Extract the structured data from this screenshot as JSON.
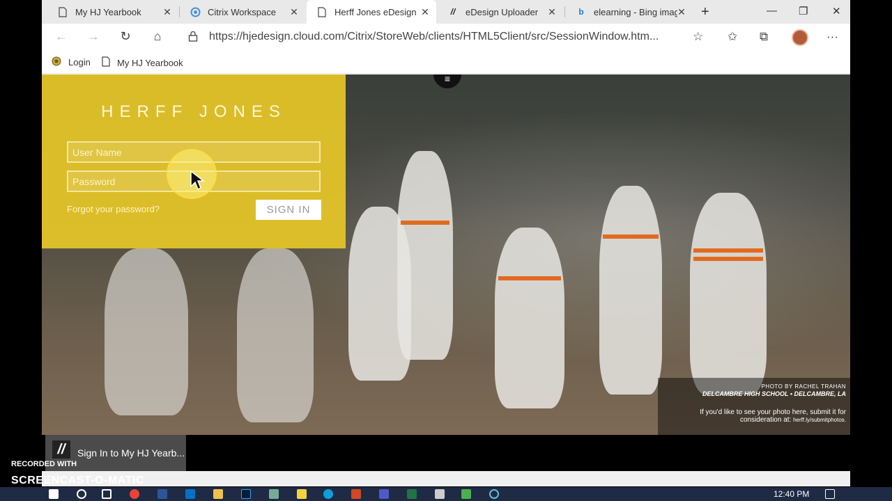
{
  "tabs": [
    {
      "label": "My HJ Yearbook",
      "icon": "page-icon",
      "active": false
    },
    {
      "label": "Citrix Workspace",
      "icon": "citrix-icon",
      "active": false
    },
    {
      "label": "Herff Jones eDesign",
      "icon": "page-icon",
      "active": true
    },
    {
      "label": "eDesign Uploader",
      "icon": "hj-logo-icon",
      "active": false
    },
    {
      "label": "elearning - Bing imag",
      "icon": "bing-icon",
      "active": false
    }
  ],
  "address": {
    "url": "https://hjedesign.cloud.com/Citrix/StoreWeb/clients/HTML5Client/src/SessionWindow.htm..."
  },
  "bookmarks": [
    {
      "label": "Login",
      "icon": "globe-icon"
    },
    {
      "label": "My HJ Yearbook",
      "icon": "page-icon"
    }
  ],
  "login": {
    "brand": "HERFF JONES",
    "username_placeholder": "User Name",
    "password_placeholder": "Password",
    "forgot": "Forgot your password?",
    "signin": "SIGN IN"
  },
  "photo_credit": {
    "line1": "PHOTO BY RACHEL TRAHAN",
    "line2": "DELCAMBRE HIGH SCHOOL • DELCAMBRE, LA",
    "line3": "If you'd like to see your photo here, submit it for",
    "line4": "consideration at:",
    "link": "herff.ly/submitphotos."
  },
  "taskbar_preview": {
    "label": "Sign In to My HJ Yearb..."
  },
  "recording": {
    "recorded_with": "RECORDED WITH",
    "brand": "SCREENCAST-O-MATIC"
  },
  "clock": {
    "time": "12:40 PM"
  },
  "colors": {
    "panel": "#e6c628",
    "tabstrip": "#e9e9e9",
    "taskbar": "#1f2a44"
  }
}
